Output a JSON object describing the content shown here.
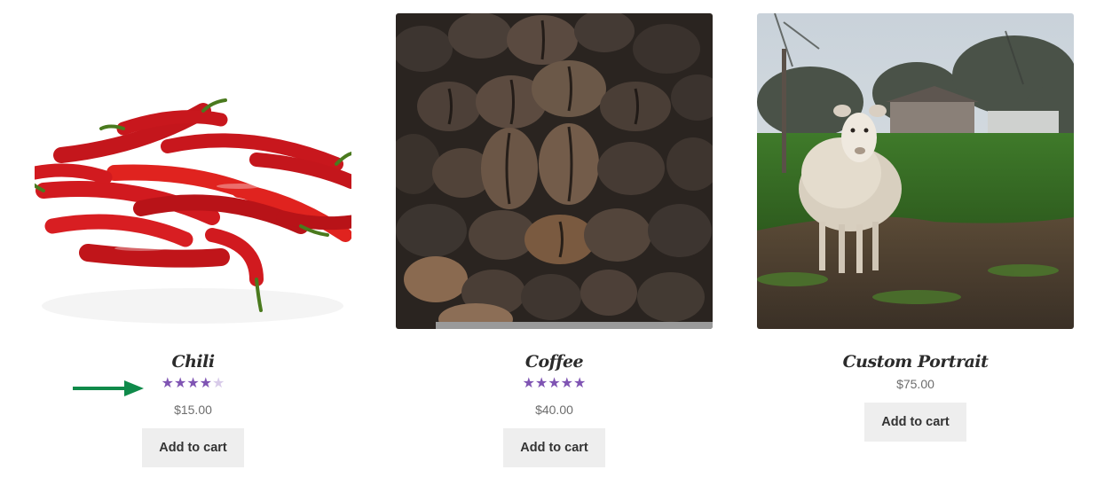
{
  "products": [
    {
      "title": "Chili",
      "rating_stars": 4,
      "rating_max": 5,
      "price": "$15.00",
      "button": "Add to cart",
      "image": "red-chili-peppers"
    },
    {
      "title": "Coffee",
      "rating_stars": 5,
      "rating_max": 5,
      "price": "$40.00",
      "button": "Add to cart",
      "image": "coffee-beans"
    },
    {
      "title": "Custom Portrait",
      "price": "$75.00",
      "button": "Add to cart",
      "image": "sheep-in-field"
    }
  ],
  "annotation": {
    "icon": "arrow-right-icon",
    "color": "#0f8a4a"
  },
  "colors": {
    "star_filled": "#7f54b3",
    "star_empty": "#d8cbe9",
    "button_bg": "#eeeeee"
  }
}
